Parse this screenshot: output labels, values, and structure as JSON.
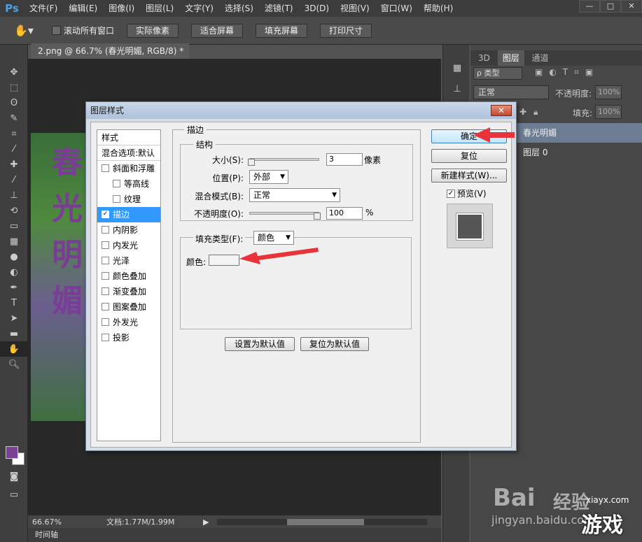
{
  "app": {
    "logo": "Ps",
    "menus": [
      "文件(F)",
      "编辑(E)",
      "图像(I)",
      "图层(L)",
      "文字(Y)",
      "选择(S)",
      "滤镜(T)",
      "3D(D)",
      "视图(V)",
      "窗口(W)",
      "帮助(H)"
    ],
    "window_controls": [
      "—",
      "□",
      "✕"
    ]
  },
  "options": {
    "scroll_all_label": "滚动所有窗口",
    "buttons": [
      "实际像素",
      "适合屏幕",
      "填充屏幕",
      "打印尺寸"
    ]
  },
  "document": {
    "tab_title": "2.png @ 66.7% (春光明媚, RGB/8) *",
    "image_text": [
      "春",
      "光",
      "明",
      "媚"
    ],
    "zoom": "66.67%",
    "doc_size": "文档:1.77M/1.99M",
    "timeline_label": "时间轴"
  },
  "layers_panel": {
    "tabs": [
      "3D",
      "图层",
      "通道"
    ],
    "filter_kind": "ρ 类型",
    "blend_mode": "正常",
    "opacity_label": "不透明度:",
    "opacity_value": "100%",
    "fill_label": "填充:",
    "fill_value": "100%",
    "layers": [
      "春光明媚",
      "图层 0"
    ]
  },
  "dialog": {
    "title": "图层样式",
    "close": "✕",
    "style_list": [
      {
        "label": "样式",
        "checkbox": false,
        "indent": false,
        "selected": false,
        "header": true
      },
      {
        "label": "混合选项:默认",
        "checkbox": false,
        "indent": false,
        "selected": false,
        "header": true
      },
      {
        "label": "斜面和浮雕",
        "checkbox": true,
        "checked": false,
        "indent": false,
        "selected": false
      },
      {
        "label": "等高线",
        "checkbox": true,
        "checked": false,
        "indent": true,
        "selected": false
      },
      {
        "label": "纹理",
        "checkbox": true,
        "checked": false,
        "indent": true,
        "selected": false
      },
      {
        "label": "描边",
        "checkbox": true,
        "checked": true,
        "indent": false,
        "selected": true
      },
      {
        "label": "内阴影",
        "checkbox": true,
        "checked": false,
        "indent": false,
        "selected": false
      },
      {
        "label": "内发光",
        "checkbox": true,
        "checked": false,
        "indent": false,
        "selected": false
      },
      {
        "label": "光泽",
        "checkbox": true,
        "checked": false,
        "indent": false,
        "selected": false
      },
      {
        "label": "颜色叠加",
        "checkbox": true,
        "checked": false,
        "indent": false,
        "selected": false
      },
      {
        "label": "渐变叠加",
        "checkbox": true,
        "checked": false,
        "indent": false,
        "selected": false
      },
      {
        "label": "图案叠加",
        "checkbox": true,
        "checked": false,
        "indent": false,
        "selected": false
      },
      {
        "label": "外发光",
        "checkbox": true,
        "checked": false,
        "indent": false,
        "selected": false
      },
      {
        "label": "投影",
        "checkbox": true,
        "checked": false,
        "indent": false,
        "selected": false
      }
    ],
    "section_title": "描边",
    "structure_title": "结构",
    "size_label": "大小(S):",
    "size_value": "3",
    "size_unit": "像素",
    "position_label": "位置(P):",
    "position_value": "外部",
    "blend_label": "混合模式(B):",
    "blend_value": "正常",
    "opacity_label": "不透明度(O):",
    "opacity_value": "100",
    "opacity_unit": "%",
    "fill_type_label": "填充类型(F):",
    "fill_type_value": "颜色",
    "color_label": "颜色:",
    "color_value": "#f4f4f4",
    "set_default": "设置为默认值",
    "reset_default": "复位为默认值",
    "ok": "确定",
    "reset": "复位",
    "new_style": "新建样式(W)...",
    "preview_label": "预览(V)",
    "preview_checked": true,
    "size_fraction": 0.0,
    "opacity_fraction": 1.0
  },
  "foreground_color": "#7b3f98",
  "background_color": "#ffffff",
  "annotation_color": "#e8333a",
  "watermark": {
    "line1": "Bai",
    "line2": "经验",
    "url1": "xiayx.com",
    "url2": "jingyan.baidu.com",
    "brand": "游戏"
  }
}
